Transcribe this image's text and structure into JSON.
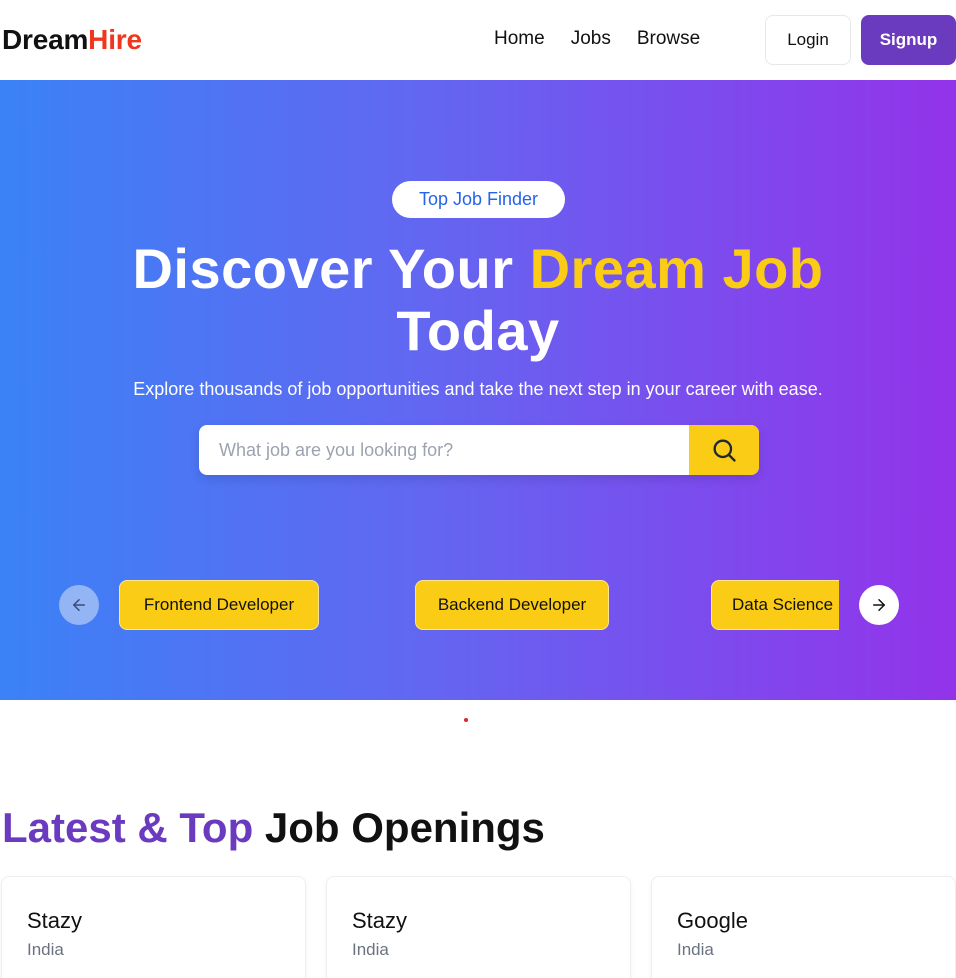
{
  "brand": {
    "part1": "Dream",
    "part2": "Hire"
  },
  "nav": {
    "links": [
      "Home",
      "Jobs",
      "Browse"
    ],
    "login": "Login",
    "signup": "Signup"
  },
  "hero": {
    "badge": "Top Job Finder",
    "headline_part1": "Discover Your ",
    "headline_highlight": "Dream Job",
    "headline_part2": "Today",
    "subtitle": "Explore thousands of job opportunities and take the next step in your career with ease.",
    "search_placeholder": "What job are you looking for?",
    "search_value": ""
  },
  "carousel": {
    "categories": [
      "Frontend Developer",
      "Backend Developer",
      "Data Science"
    ]
  },
  "section": {
    "title_highlight": "Latest & Top",
    "title_rest": " Job Openings"
  },
  "jobs": [
    {
      "company": "Stazy",
      "location": "India"
    },
    {
      "company": "Stazy",
      "location": "India"
    },
    {
      "company": "Google",
      "location": "India"
    }
  ],
  "colors": {
    "brand_accent": "#f0371e",
    "primary_purple": "#6b3bbf",
    "highlight_yellow": "#facc15",
    "gradient_start": "#3b82f6",
    "gradient_end": "#9333ea"
  }
}
